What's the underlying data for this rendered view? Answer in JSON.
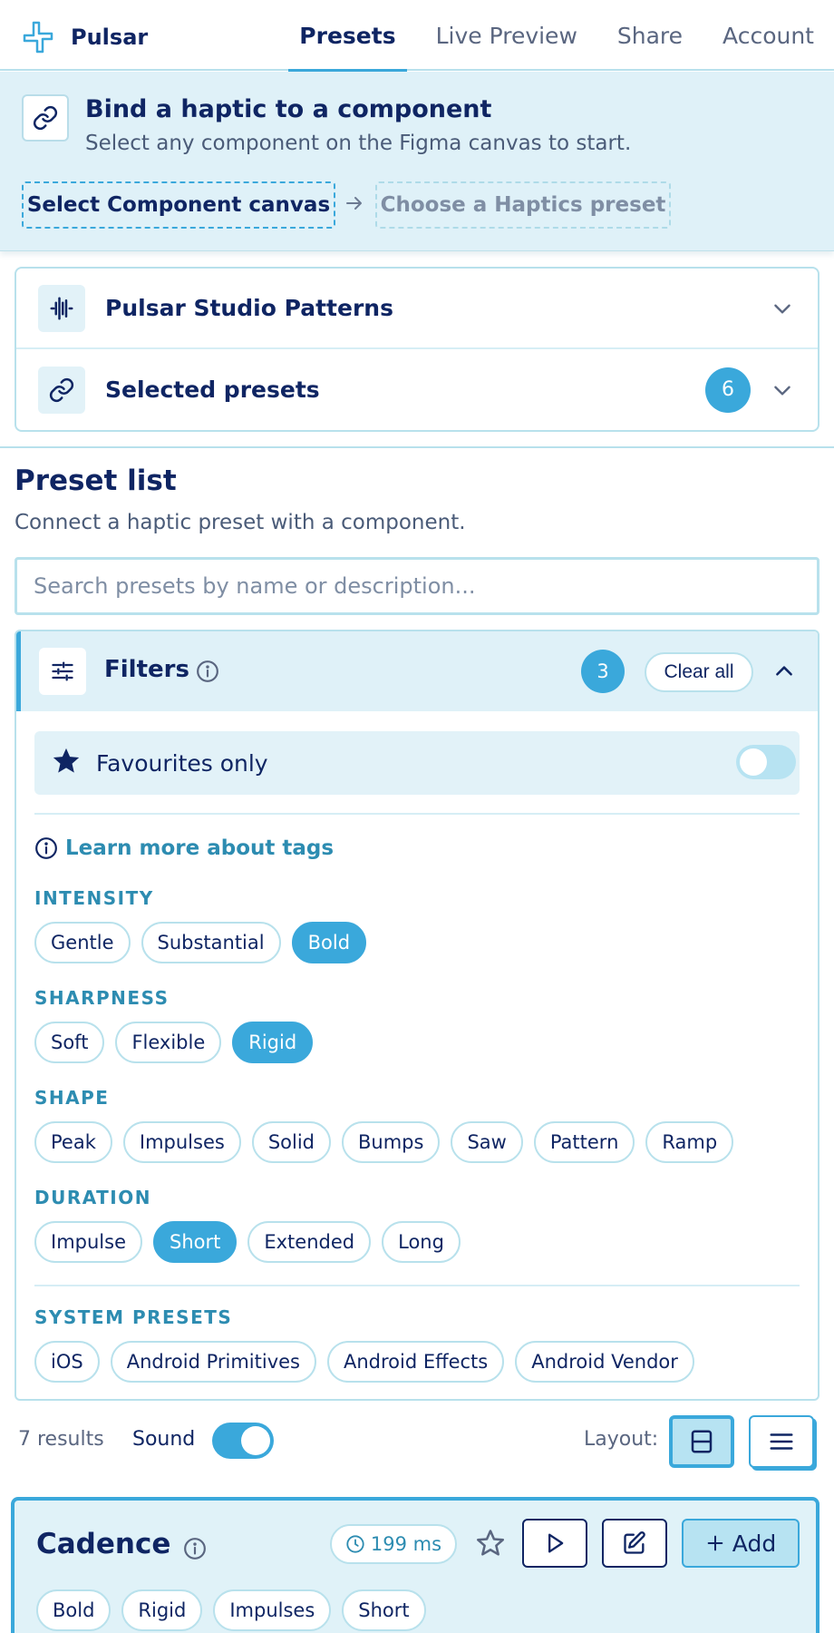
{
  "app": {
    "name": "Pulsar"
  },
  "nav": {
    "tabs": [
      "Presets",
      "Live Preview",
      "Share",
      "Account"
    ]
  },
  "banner": {
    "title": "Bind a haptic to a component",
    "subtitle": "Select any component on the Figma canvas to start.",
    "step1": "Select Component canvas",
    "step2": "Choose a Haptics preset"
  },
  "accordion": {
    "studio_label": "Pulsar Studio Patterns",
    "selected_label": "Selected presets",
    "selected_count": "6"
  },
  "preset_list": {
    "title": "Preset list",
    "subtitle": "Connect a haptic preset with a component.",
    "search_placeholder": "Search presets by name or description..."
  },
  "filters": {
    "label": "Filters",
    "count": "3",
    "clear_label": "Clear all",
    "favourites_label": "Favourites only",
    "favourites_on": false,
    "learn_more": "Learn more about tags",
    "groups": {
      "intensity": {
        "label": "INTENSITY",
        "chips": [
          "Gentle",
          "Substantial",
          "Bold"
        ],
        "selected": [
          "Bold"
        ]
      },
      "sharpness": {
        "label": "SHARPNESS",
        "chips": [
          "Soft",
          "Flexible",
          "Rigid"
        ],
        "selected": [
          "Rigid"
        ]
      },
      "shape": {
        "label": "SHAPE",
        "chips": [
          "Peak",
          "Impulses",
          "Solid",
          "Bumps",
          "Saw",
          "Pattern",
          "Ramp"
        ],
        "selected": []
      },
      "duration": {
        "label": "DURATION",
        "chips": [
          "Impulse",
          "Short",
          "Extended",
          "Long"
        ],
        "selected": [
          "Short"
        ]
      },
      "system": {
        "label": "SYSTEM PRESETS",
        "chips": [
          "iOS",
          "Android Primitives",
          "Android Effects",
          "Android Vendor"
        ],
        "selected": []
      }
    }
  },
  "results": {
    "count_label": "7 results",
    "sound_label": "Sound",
    "sound_on": true,
    "layout_label": "Layout:",
    "layout_selected": "grid"
  },
  "card": {
    "name": "Cadence",
    "duration": "199 ms",
    "add_label": "Add",
    "tags": [
      "Bold",
      "Rigid",
      "Impulses",
      "Short"
    ]
  },
  "colors": {
    "accent": "#3aa8db",
    "navy": "#0f2563",
    "panel": "#dff1f8",
    "border": "#b8e1ec",
    "tag_text": "#2d8cb1"
  },
  "icons": [
    "pulsar-logo-icon",
    "link-icon",
    "arrow-right-icon",
    "waveform-icon",
    "chevron-down-icon",
    "sliders-icon",
    "info-icon",
    "chevron-up-icon",
    "star-icon",
    "grid-layout-icon",
    "list-layout-icon",
    "clock-icon",
    "star-outline-icon",
    "play-icon",
    "edit-icon",
    "plus-icon"
  ]
}
